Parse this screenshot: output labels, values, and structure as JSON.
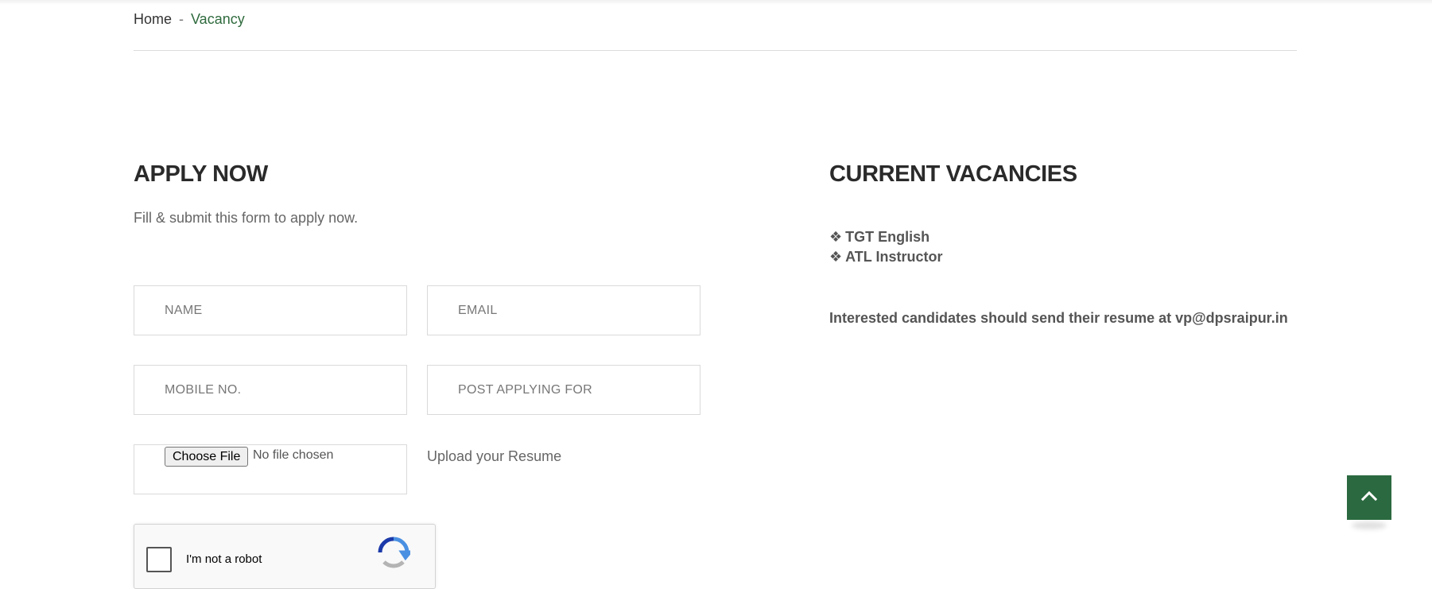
{
  "breadcrumb": {
    "home": "Home",
    "separator": "-",
    "current": "Vacancy"
  },
  "apply": {
    "heading": "APPLY NOW",
    "subtext": "Fill & submit this form to apply now.",
    "fields": {
      "name_placeholder": "NAME",
      "email_placeholder": "EMAIL",
      "mobile_placeholder": "MOBILE NO.",
      "post_placeholder": "POST APPLYING FOR"
    },
    "file": {
      "button_label": "Choose File",
      "status": "No file chosen",
      "upload_label": "Upload your Resume"
    },
    "recaptcha": {
      "label": "I'm not a robot"
    }
  },
  "vacancies": {
    "heading": "CURRENT VACANCIES",
    "bullet": "❖",
    "items": [
      "TGT English",
      "ATL Instructor"
    ],
    "note": "Interested candidates should send their resume at vp@dpsraipur.in"
  },
  "colors": {
    "accent": "#2b6a40",
    "breadcrumb_current": "#2f6b3e"
  },
  "icons": {
    "scroll_top": "chevron-up-icon",
    "recaptcha": "recaptcha-logo-icon"
  }
}
